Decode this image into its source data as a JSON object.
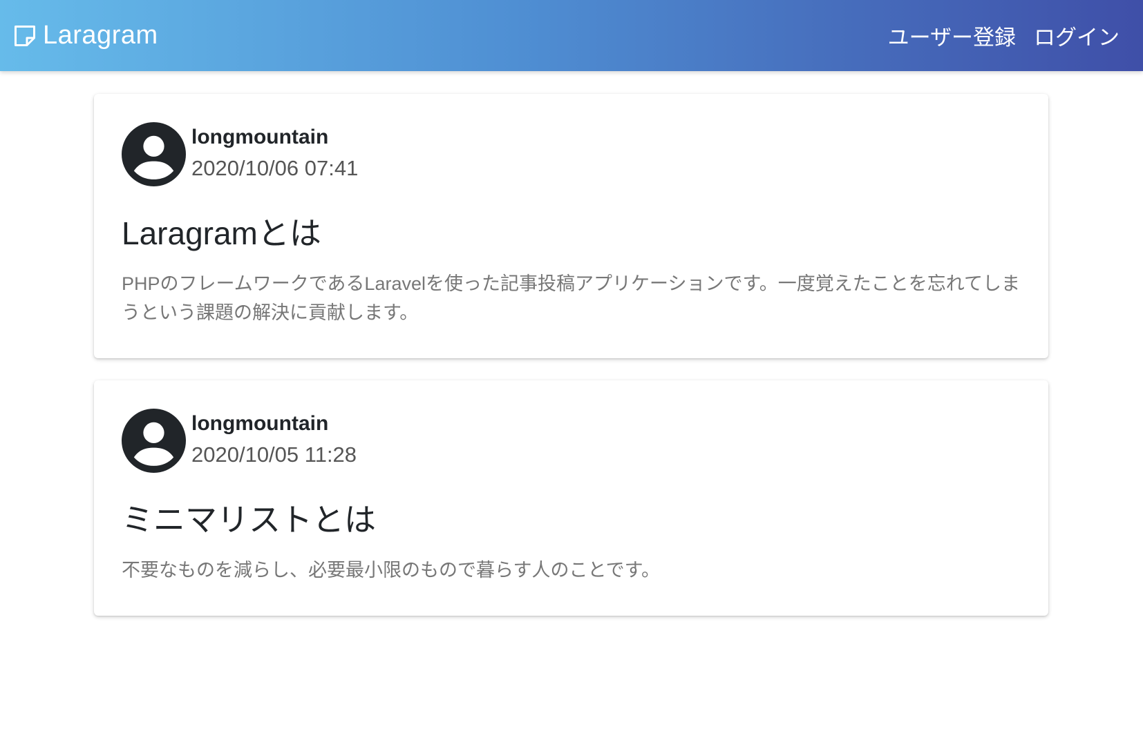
{
  "navbar": {
    "brand_icon": "note-icon",
    "brand_name": "Laragram",
    "register_label": "ユーザー登録",
    "login_label": "ログイン"
  },
  "posts": [
    {
      "avatar_icon": "account-circle-icon",
      "author": "longmountain",
      "date": "2020/10/06 07:41",
      "title": "Laragramとは",
      "body": "PHPのフレームワークであるLaravelを使った記事投稿アプリケーションです。一度覚えたことを忘れてしまうという課題の解決に貢献します。"
    },
    {
      "avatar_icon": "account-circle-icon",
      "author": "longmountain",
      "date": "2020/10/05 11:28",
      "title": "ミニマリストとは",
      "body": "不要なものを減らし、必要最小限のもので暮らす人のことです。"
    }
  ],
  "colors": {
    "navbar_gradient_start": "#66bbea",
    "navbar_gradient_end": "#3f4fa8",
    "avatar": "#212529"
  }
}
